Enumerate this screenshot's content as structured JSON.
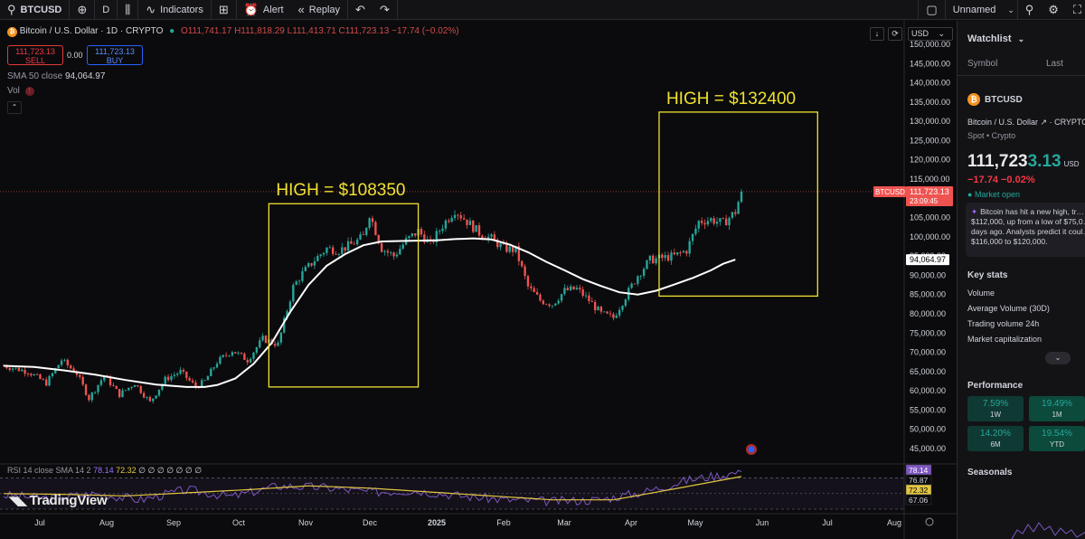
{
  "toolbar": {
    "symbol": "BTCUSD",
    "interval": "D",
    "indicators": "Indicators",
    "alert": "Alert",
    "replay": "Replay",
    "layout_name": "Unnamed"
  },
  "legend": {
    "title": "Bitcoin / U.S. Dollar · 1D · CRYPTO",
    "ohlc": "O111,741.17 H111,818.29 L111,413.71 C111,723.13 −17.74 (−0.02%)",
    "sell_price": "111,723.13",
    "sell_label": "SELL",
    "buy_price": "111,723.13",
    "buy_label": "BUY",
    "spread": "0.00",
    "sma_label": "SMA 50 close",
    "sma_value": "94,064.97",
    "vol_label": "Vol",
    "rsi_label": "RSI 14 close SMA 14 2",
    "rsi_value": "78.14",
    "rsi_sma_value": "72.32",
    "rsi_empty": "∅ ∅ ∅ ∅ ∅ ∅ ∅",
    "currency": "USD",
    "logo": "TradingView"
  },
  "chart_data": {
    "type": "candlestick",
    "title": "Bitcoin / U.S. Dollar · 1D · CRYPTO",
    "y_ticks": [
      "150,000.00",
      "145,000.00",
      "140,000.00",
      "135,000.00",
      "130,000.00",
      "125,000.00",
      "120,000.00",
      "115,000.00",
      "110,000.00",
      "105,000.00",
      "100,000.00",
      "95,000.00",
      "90,000.00",
      "85,000.00",
      "80,000.00",
      "75,000.00",
      "70,000.00",
      "65,000.00",
      "60,000.00",
      "55,000.00",
      "50,000.00",
      "45,000.00"
    ],
    "x_ticks": [
      "Jul",
      "Aug",
      "Sep",
      "Oct",
      "Nov",
      "Dec",
      "2025",
      "Feb",
      "Mar",
      "Apr",
      "May",
      "Jun",
      "Jul",
      "Aug"
    ],
    "price_path": [
      [
        0,
        66500
      ],
      [
        8,
        65000
      ],
      [
        14,
        62000
      ],
      [
        19,
        68000
      ],
      [
        24,
        64500
      ],
      [
        28,
        58000
      ],
      [
        33,
        64000
      ],
      [
        38,
        59000
      ],
      [
        43,
        62000
      ],
      [
        48,
        57000
      ],
      [
        53,
        63000
      ],
      [
        58,
        65000
      ],
      [
        63,
        61000
      ],
      [
        66,
        62500
      ],
      [
        70,
        67500
      ],
      [
        75,
        70500
      ],
      [
        80,
        68000
      ],
      [
        85,
        73500
      ],
      [
        90,
        72000
      ],
      [
        95,
        87000
      ],
      [
        98,
        90500
      ],
      [
        102,
        94000
      ],
      [
        106,
        97000
      ],
      [
        110,
        96500
      ],
      [
        114,
        98000
      ],
      [
        118,
        100000
      ],
      [
        120,
        106000
      ],
      [
        124,
        97000
      ],
      [
        128,
        95000
      ],
      [
        132,
        99000
      ],
      [
        136,
        101500
      ],
      [
        140,
        98000
      ],
      [
        144,
        103000
      ],
      [
        148,
        107000
      ],
      [
        152,
        104000
      ],
      [
        156,
        101000
      ],
      [
        160,
        99500
      ],
      [
        164,
        97000
      ],
      [
        168,
        96500
      ],
      [
        172,
        87000
      ],
      [
        176,
        83500
      ],
      [
        180,
        82500
      ],
      [
        184,
        86000
      ],
      [
        188,
        86500
      ],
      [
        192,
        83500
      ],
      [
        196,
        80000
      ],
      [
        200,
        79000
      ],
      [
        204,
        84500
      ],
      [
        208,
        90000
      ],
      [
        212,
        94000
      ],
      [
        216,
        94500
      ],
      [
        220,
        95000
      ],
      [
        224,
        96500
      ],
      [
        228,
        104000
      ],
      [
        232,
        104500
      ],
      [
        236,
        103500
      ],
      [
        240,
        106500
      ],
      [
        242,
        111700
      ]
    ],
    "sma_path": [
      [
        0,
        66500
      ],
      [
        10,
        66200
      ],
      [
        20,
        65300
      ],
      [
        30,
        64200
      ],
      [
        40,
        62800
      ],
      [
        50,
        61600
      ],
      [
        60,
        61000
      ],
      [
        66,
        61000
      ],
      [
        70,
        61500
      ],
      [
        76,
        63200
      ],
      [
        82,
        67000
      ],
      [
        88,
        72500
      ],
      [
        94,
        80500
      ],
      [
        100,
        87500
      ],
      [
        106,
        92500
      ],
      [
        112,
        95500
      ],
      [
        118,
        97800
      ],
      [
        124,
        98800
      ],
      [
        130,
        98900
      ],
      [
        136,
        99000
      ],
      [
        142,
        99100
      ],
      [
        148,
        99400
      ],
      [
        154,
        99600
      ],
      [
        160,
        99300
      ],
      [
        166,
        98000
      ],
      [
        172,
        96000
      ],
      [
        178,
        93500
      ],
      [
        184,
        91300
      ],
      [
        190,
        89000
      ],
      [
        196,
        87200
      ],
      [
        202,
        85600
      ],
      [
        208,
        85000
      ],
      [
        214,
        86000
      ],
      [
        220,
        87600
      ],
      [
        226,
        89300
      ],
      [
        232,
        91300
      ],
      [
        236,
        93000
      ],
      [
        240,
        94065
      ]
    ],
    "annotations": [
      {
        "text": "HIGH = $108350",
        "x_range": [
          87,
          136
        ],
        "y_range": [
          61000,
          108600
        ]
      },
      {
        "text": "HIGH = $132400",
        "x_range": [
          215,
          267
        ],
        "y_range": [
          84600,
          132400
        ]
      }
    ],
    "last_price_label": "BTCUSD",
    "last_price": "111,723.13",
    "countdown": "23:09:45",
    "sma_last": "94,064.97",
    "rsi": {
      "ticks": [
        "78.14",
        "76.87",
        "72.32",
        "67.06"
      ],
      "rsi_path": [
        [
          0,
          48
        ],
        [
          15,
          44
        ],
        [
          30,
          50
        ],
        [
          45,
          42
        ],
        [
          60,
          55
        ],
        [
          75,
          46
        ],
        [
          90,
          60
        ],
        [
          105,
          58
        ],
        [
          120,
          52
        ],
        [
          135,
          54
        ],
        [
          150,
          47
        ],
        [
          165,
          42
        ],
        [
          180,
          40
        ],
        [
          195,
          42
        ],
        [
          210,
          52
        ],
        [
          225,
          68
        ],
        [
          242,
          78
        ]
      ],
      "sma_path": [
        [
          0,
          50
        ],
        [
          20,
          49
        ],
        [
          40,
          47
        ],
        [
          60,
          51
        ],
        [
          80,
          55
        ],
        [
          100,
          60
        ],
        [
          120,
          57
        ],
        [
          140,
          52
        ],
        [
          160,
          47
        ],
        [
          180,
          42
        ],
        [
          200,
          42
        ],
        [
          220,
          56
        ],
        [
          242,
          72
        ]
      ]
    }
  },
  "sidebar": {
    "watchlist_title": "Watchlist",
    "col_symbol": "Symbol",
    "col_last": "Last",
    "symbol": "BTCUSD",
    "full_name": "Bitcoin / U.S. Dollar",
    "exchange": "CRYPTO",
    "type": "Spot • Crypto",
    "price_main": "111,723",
    "price_dec": "3.13",
    "currency": "USD",
    "change": "−17.74  −0.02%",
    "market": "Market open",
    "news": "Bitcoin has hit a new high, tr… $112,000, up from a low of $75,0… days ago. Analysts predict it coul… $116,000 to $120,000.",
    "key_stats_title": "Key stats",
    "key_stats": [
      "Volume",
      "Average Volume (30D)",
      "Trading volume 24h",
      "Market capitalization"
    ],
    "performance_title": "Performance",
    "performance": [
      {
        "value": "7.59%",
        "label": "1W"
      },
      {
        "value": "19.49%",
        "label": "1M"
      },
      {
        "value": "14.20%",
        "label": "6M"
      },
      {
        "value": "19.54%",
        "label": "YTD"
      }
    ],
    "seasonals_title": "Seasonals"
  },
  "colors": {
    "up": "#26a69a",
    "down": "#ef5350",
    "sma": "#ffffff",
    "box": "#f0e130",
    "rsi": "#7e57c2",
    "rsi_sma": "#e3c642"
  }
}
